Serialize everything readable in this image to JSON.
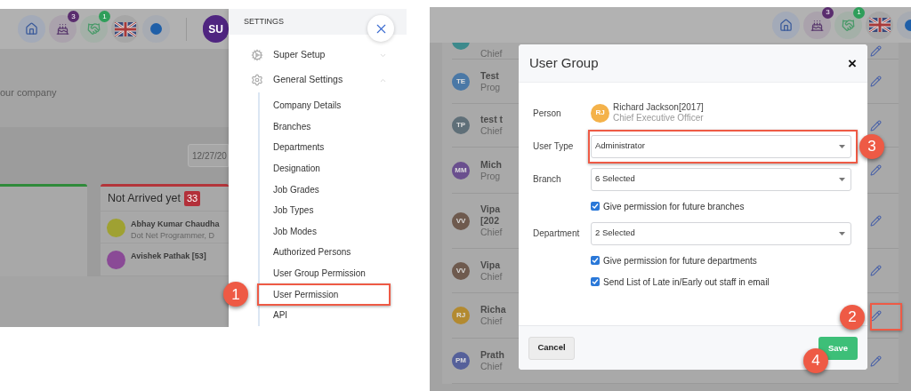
{
  "left_screen": {
    "toolbar": [
      {
        "kind": "home"
      },
      {
        "kind": "cake",
        "badge": "3",
        "color": "#5a2d6e"
      },
      {
        "kind": "handshake",
        "badge": "1",
        "color": "#2f9e5a"
      },
      {
        "kind": "flag"
      },
      {
        "kind": "status"
      }
    ],
    "avatar": "SU",
    "subtitle": "our company",
    "date": "12/27/20",
    "card": {
      "title": "Not Arrived yet",
      "count": "33",
      "people": [
        {
          "name": "Abhay Kumar Chaudha",
          "role": "Dot Net Programmer, D",
          "color": "#9fa132"
        },
        {
          "name": "Avishek Pathak [53]",
          "color": "#8a4a96"
        }
      ]
    },
    "settings": {
      "title": "SETTINGS",
      "sections": [
        {
          "label": "Super Setup",
          "kind": "setup",
          "expanded": false
        },
        {
          "label": "General Settings",
          "kind": "general",
          "expanded": true,
          "children": [
            {
              "label": "Company Details"
            },
            {
              "label": "Branches"
            },
            {
              "label": "Departments"
            },
            {
              "label": "Designation"
            },
            {
              "label": "Job Grades"
            },
            {
              "label": "Job Types"
            },
            {
              "label": "Job Modes"
            },
            {
              "label": "Authorized Persons"
            },
            {
              "label": "User Group Permission"
            },
            {
              "label": "User Permission",
              "callout": "1"
            },
            {
              "label": "API"
            }
          ]
        }
      ]
    }
  },
  "right_screen": {
    "toolbar": [
      {
        "kind": "home"
      },
      {
        "kind": "cake",
        "badge": "3",
        "color": "#5a2d6e"
      },
      {
        "kind": "handshake",
        "badge": "1",
        "color": "#2f9e5a"
      },
      {
        "kind": "flag"
      },
      {
        "kind": "status"
      }
    ],
    "rows": [
      {
        "color": "#3d8a8c",
        "name_lines": [],
        "subtitle": "Chief"
      },
      {
        "initials": "TE",
        "color": "#4a78a6",
        "name_lines": [
          "Test"
        ],
        "subtitle": "Prog"
      },
      {
        "initials": "TP",
        "color": "#5f6f78",
        "name_lines": [
          "test t"
        ],
        "subtitle": "Chief"
      },
      {
        "initials": "MM",
        "color": "#6a4f8e",
        "name_lines": [
          "Mich"
        ],
        "subtitle": "Prog"
      },
      {
        "initials": "VV",
        "color": "#6e5a4e",
        "name_lines": [
          "Vipa",
          "[202"
        ],
        "subtitle": "Chief"
      },
      {
        "initials": "VV",
        "color": "#6e5a4e",
        "name_lines": [
          "Vipa"
        ],
        "subtitle": "Chief"
      },
      {
        "initials": "RJ",
        "color": "#b38a30",
        "name_lines": [
          "Richa"
        ],
        "subtitle": "Chief",
        "callout": "2"
      },
      {
        "initials": "PM",
        "color": "#55609a",
        "name_lines": [
          "Prath"
        ],
        "subtitle": "Chief"
      }
    ],
    "dialog": {
      "title": "User Group",
      "close": "×",
      "person": {
        "label": "Person",
        "initials": "RJ",
        "name": "Richard Jackson[2017]",
        "role": "Chief Executive Officer"
      },
      "fields": [
        {
          "kind": "select",
          "label": "User Type",
          "value": "Administrator",
          "callout": "3"
        },
        {
          "kind": "select",
          "label": "Branch",
          "value": "6 Selected"
        },
        {
          "kind": "checkbox",
          "label": "Give permission for future branches",
          "checked": true
        },
        {
          "kind": "select",
          "label": "Department",
          "value": "2 Selected"
        },
        {
          "kind": "checkbox",
          "label": "Give permission for future departments",
          "checked": true
        },
        {
          "kind": "checkbox",
          "label": "Send List of Late in/Early out staff in email",
          "checked": true
        }
      ],
      "cancel": "Cancel",
      "save": {
        "label": "Save",
        "callout": "4"
      }
    }
  }
}
